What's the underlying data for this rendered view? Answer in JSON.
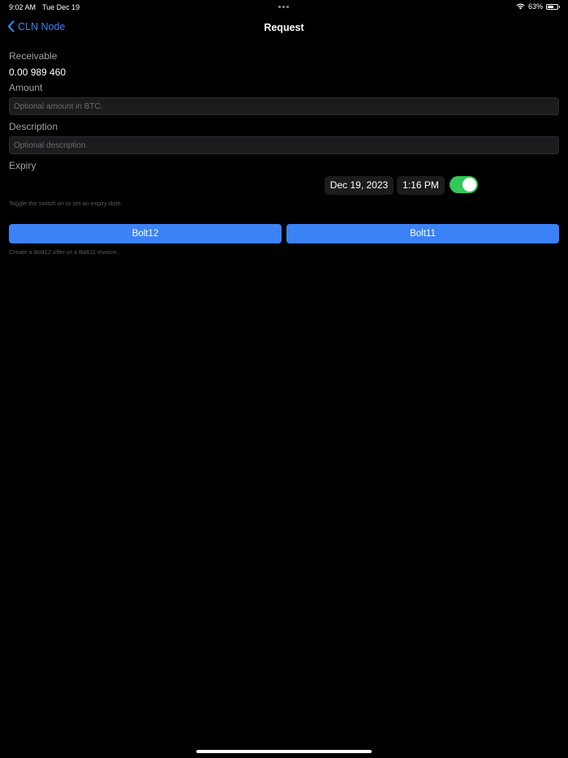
{
  "status_bar": {
    "time": "9:02 AM",
    "date": "Tue Dec 19",
    "battery_text": "63%",
    "battery_level": 0.63
  },
  "nav": {
    "back_label": "CLN Node",
    "title": "Request"
  },
  "receivable": {
    "label": "Receivable",
    "value": "0.00 989 460"
  },
  "amount": {
    "label": "Amount",
    "placeholder": "Optional amount in BTC."
  },
  "description": {
    "label": "Description",
    "placeholder": "Optional description."
  },
  "expiry": {
    "label": "Expiry",
    "date": "Dec 19, 2023",
    "time": "1:16 PM",
    "enabled": true,
    "hint": "Toggle the switch on to set an expiry date."
  },
  "actions": {
    "bolt12_label": "Bolt12",
    "bolt11_label": "Bolt11",
    "hint": "Create a Bolt12 offer or a Bolt11 invoice."
  },
  "colors": {
    "accent": "#3b82f6",
    "toggle_on": "#34c759",
    "background": "#000000"
  }
}
